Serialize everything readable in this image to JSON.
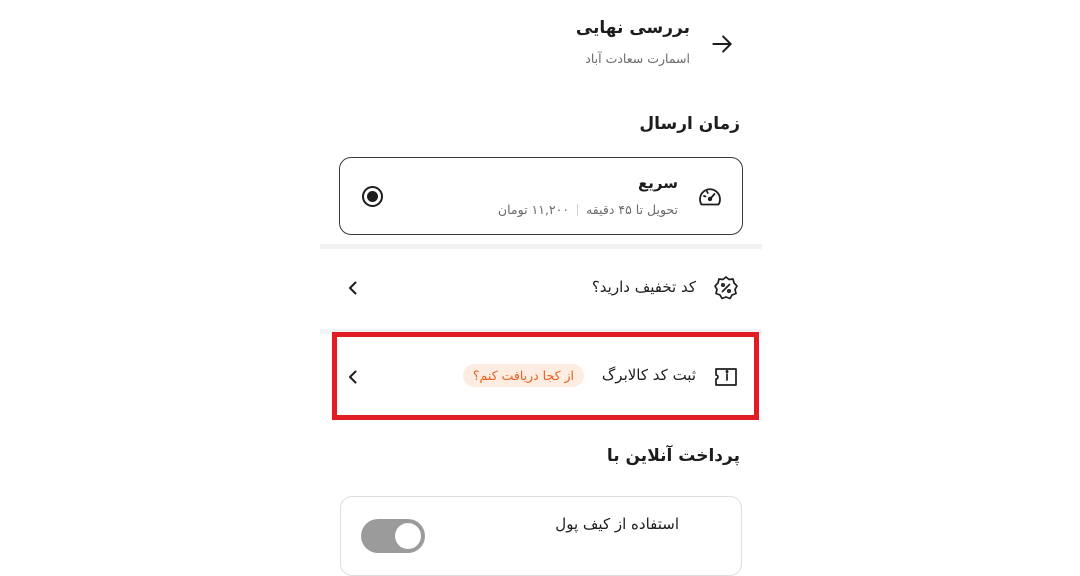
{
  "header": {
    "title": "بررسی نهایی",
    "subtitle": "اسمارت سعادت آباد",
    "back_icon": "arrow-right-icon"
  },
  "delivery": {
    "section_title": "زمان ارسال",
    "option": {
      "title": "سریع",
      "eta": "تحویل تا ۴۵ دقیقه",
      "price": "۱۱,۲۰۰ تومان",
      "selected": true,
      "icon": "speedometer-icon"
    }
  },
  "discount": {
    "label": "کد تخفیف دارید؟",
    "icon": "percent-badge-icon"
  },
  "kalabarg": {
    "label": "ثبت کد کالابرگ",
    "help_link": "از کجا دریافت کنم؟",
    "icon": "card-info-icon"
  },
  "payment": {
    "section_title": "پرداخت آنلاین با",
    "wallet_label": "استفاده از کیف پول",
    "wallet_enabled": false
  },
  "colors": {
    "accent_orange": "#e8601c",
    "badge_bg": "#fdece2",
    "highlight_red": "#e11c25",
    "divider": "#f1f2f4"
  }
}
